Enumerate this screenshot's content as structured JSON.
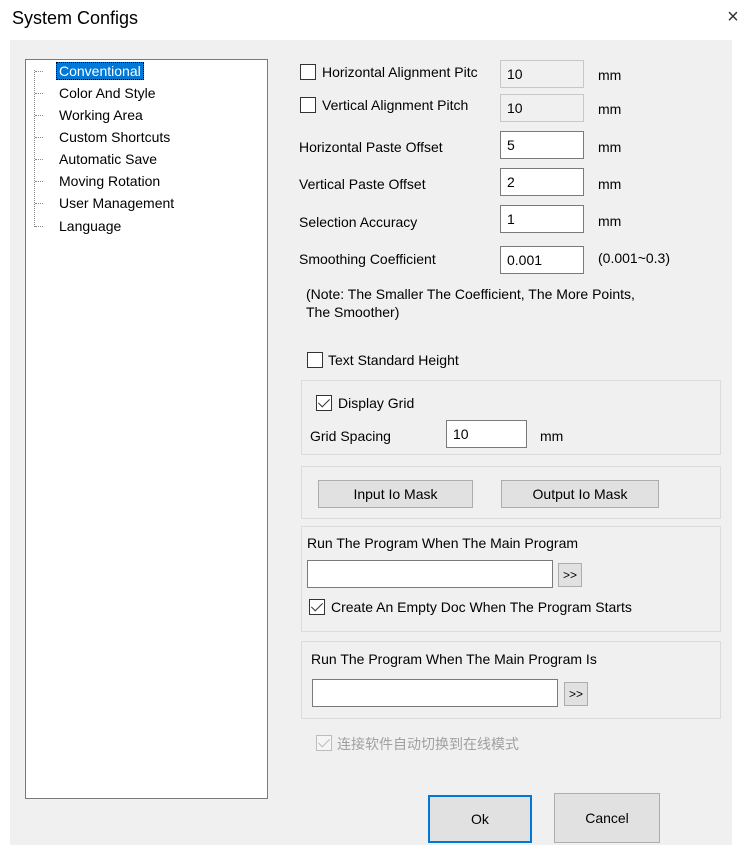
{
  "window": {
    "title": "System Configs",
    "close_glyph": "×"
  },
  "tree": {
    "items": [
      {
        "label": "Conventional",
        "selected": true
      },
      {
        "label": "Color And Style"
      },
      {
        "label": "Working Area"
      },
      {
        "label": "Custom Shortcuts"
      },
      {
        "label": "Automatic Save"
      },
      {
        "label": "Moving Rotation"
      },
      {
        "label": "User Management"
      },
      {
        "label": "Language"
      }
    ]
  },
  "settings": {
    "h_align_pitch": {
      "label": "Horizontal Alignment Pitc",
      "value": "10",
      "unit": "mm",
      "checked": false
    },
    "v_align_pitch": {
      "label": "Vertical Alignment Pitch",
      "value": "10",
      "unit": "mm",
      "checked": false
    },
    "h_paste_offset": {
      "label": "Horizontal Paste Offset",
      "value": "5",
      "unit": "mm"
    },
    "v_paste_offset": {
      "label": "Vertical Paste Offset",
      "value": "2",
      "unit": "mm"
    },
    "selection_accuracy": {
      "label": "Selection Accuracy",
      "value": "1",
      "unit": "mm"
    },
    "smoothing": {
      "label": "Smoothing Coefficient",
      "value": "0.001",
      "range": "(0.001~0.3)"
    },
    "note_line1": "(Note: The Smaller The Coefficient, The More Points,",
    "note_line2": "The Smoother)",
    "text_std_height": {
      "label": "Text Standard Height",
      "checked": false
    },
    "display_grid": {
      "label": "Display Grid",
      "checked": true
    },
    "grid_spacing": {
      "label": "Grid Spacing",
      "value": "10",
      "unit": "mm"
    },
    "input_io_mask": "Input Io Mask",
    "output_io_mask": "Output Io Mask",
    "run_program_1": {
      "label": "Run The Program When The Main Program",
      "value": "",
      "browse": ">>"
    },
    "empty_doc": {
      "label": "Create An Empty Doc When The Program Starts",
      "checked": true
    },
    "run_program_2": {
      "label": "Run The Program When The Main Program Is",
      "value": "",
      "browse": ">>"
    },
    "online_mode": {
      "label": "连接软件自动切换到在线模式",
      "checked": true,
      "disabled": true
    }
  },
  "buttons": {
    "ok": "Ok",
    "cancel": "Cancel"
  }
}
